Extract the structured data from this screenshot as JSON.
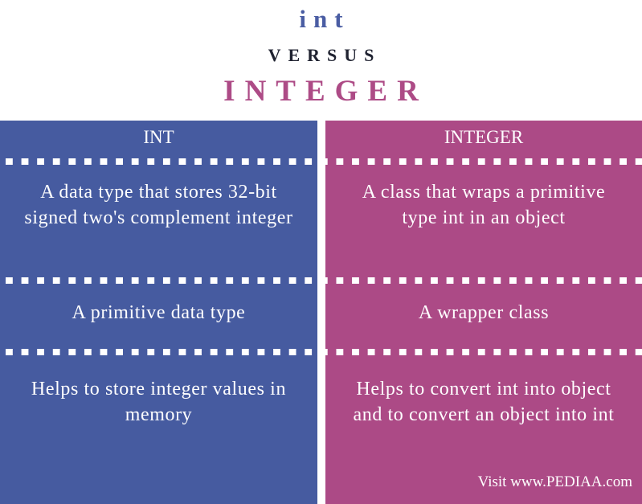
{
  "title": {
    "term_a": "int",
    "versus": "VERSUS",
    "term_b": "INTEGER"
  },
  "colors": {
    "left_panel": "#465ba0",
    "right_panel": "#ac4a86",
    "versus_text": "#1f2230"
  },
  "columns": [
    {
      "header": "INT",
      "rows": [
        "A data type that stores 32-bit signed two's complement integer",
        "A primitive data type",
        "Helps to store integer values in memory"
      ]
    },
    {
      "header": "INTEGER",
      "rows": [
        "A class that wraps a primitive type int in an object",
        "A wrapper class",
        "Helps to convert int into object and to convert an object into int"
      ]
    }
  ],
  "credit": "Visit www.PEDIAA.com"
}
